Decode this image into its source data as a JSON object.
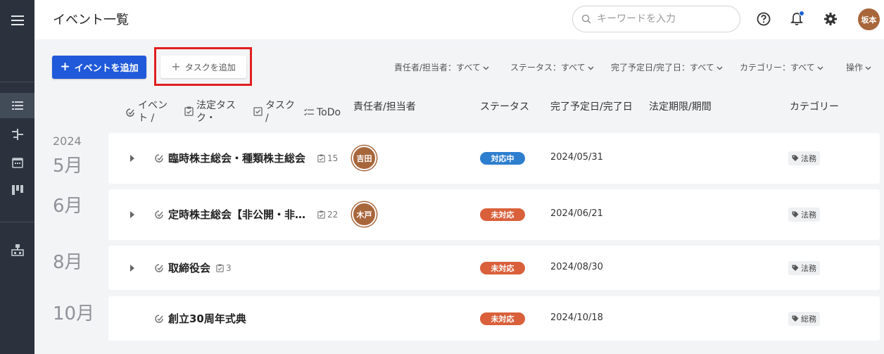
{
  "header": {
    "title": "イベント一覧",
    "search_placeholder": "キーワードを入力",
    "user_initials": "坂本"
  },
  "toolbar": {
    "add_event_label": "イベントを追加",
    "add_task_label": "タスクを追加",
    "filters": [
      {
        "label": "責任者/担当者：すべて"
      },
      {
        "label": "ステータス：すべて"
      },
      {
        "label": "完了予定日/完了日：すべて"
      },
      {
        "label": "カテゴリー：すべて"
      },
      {
        "label": "操作"
      }
    ]
  },
  "columns": {
    "event": "イベン\nト /",
    "legal_task": "法定タス\nク・",
    "task": "タスク\n/",
    "todo": "ToDo",
    "owner": "責任者/担当者",
    "status": "ステータス",
    "due": "完了予定日/完了日",
    "legal_deadline": "法定期限/期間",
    "category": "カテゴリー"
  },
  "year": "2024",
  "groups": [
    {
      "month": "5月",
      "name": "臨時株主総会・種類株主総会",
      "count": "15",
      "owner": "吉田",
      "status": "対応中",
      "date": "2024/05/31",
      "category": "法務"
    },
    {
      "month": "6月",
      "name": "定時株主総会【非公開・非…",
      "count": "22",
      "owner": "木戸",
      "status": "未対応",
      "date": "2024/06/21",
      "category": "法務"
    },
    {
      "month": "8月",
      "name": "取締役会",
      "count": "3",
      "owner": "",
      "status": "未対応",
      "date": "2024/08/30",
      "category": "法務"
    },
    {
      "month": "10月",
      "name": "創立30周年式典",
      "count": "",
      "owner": "",
      "status": "未対応",
      "date": "2024/10/18",
      "category": "総務"
    }
  ],
  "colors": {
    "primary": "#2059d9",
    "status_in_progress": "#2e7ecf",
    "status_not_started": "#d9603b",
    "highlight": "#e02020",
    "sidebar": "#2b323d"
  }
}
